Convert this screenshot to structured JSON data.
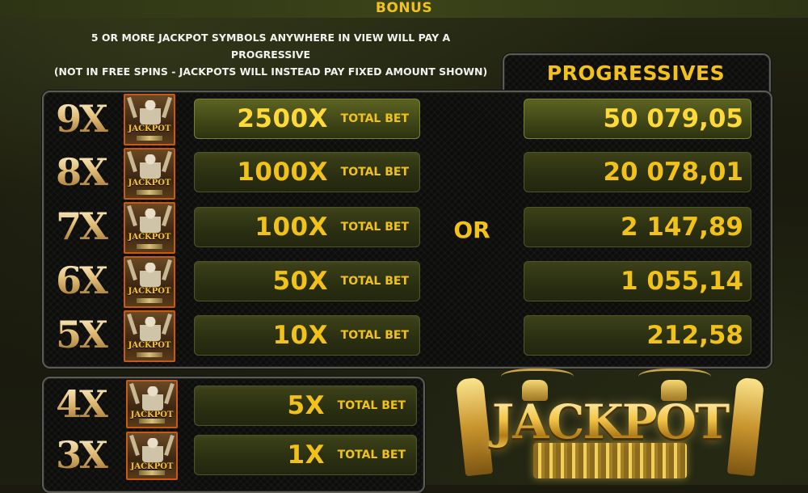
{
  "header": {
    "title": "BONUS"
  },
  "notice": {
    "lines": [
      "5 OR MORE JACKPOT SYMBOLS ANYWHERE IN VIEW WILL PAY A",
      "PROGRESSIVE",
      "(NOT IN FREE SPINS - JACKPOTS WILL INSTEAD PAY FIXED AMOUNT SHOWN)"
    ]
  },
  "progressives": {
    "title": "PROGRESSIVES",
    "or_label": "OR",
    "values": [
      "50 079,05",
      "20 078,01",
      "2 147,89",
      "1 055,14",
      "212,58"
    ]
  },
  "symbol_label": "JACKPOT",
  "paytable": {
    "total_bet_label": "TOTAL BET",
    "rows": [
      {
        "multiplier": "9X",
        "amount": "2500X"
      },
      {
        "multiplier": "8X",
        "amount": "1000X"
      },
      {
        "multiplier": "7X",
        "amount": "100X"
      },
      {
        "multiplier": "6X",
        "amount": "50X"
      },
      {
        "multiplier": "5X",
        "amount": "10X"
      },
      {
        "multiplier": "4X",
        "amount": "5X"
      },
      {
        "multiplier": "3X",
        "amount": "1X"
      }
    ]
  },
  "logo": {
    "text": "JACKPOT"
  },
  "colors": {
    "gold": "#f2c21a",
    "panel": "#0d0d0b",
    "row": "#2b3012"
  }
}
